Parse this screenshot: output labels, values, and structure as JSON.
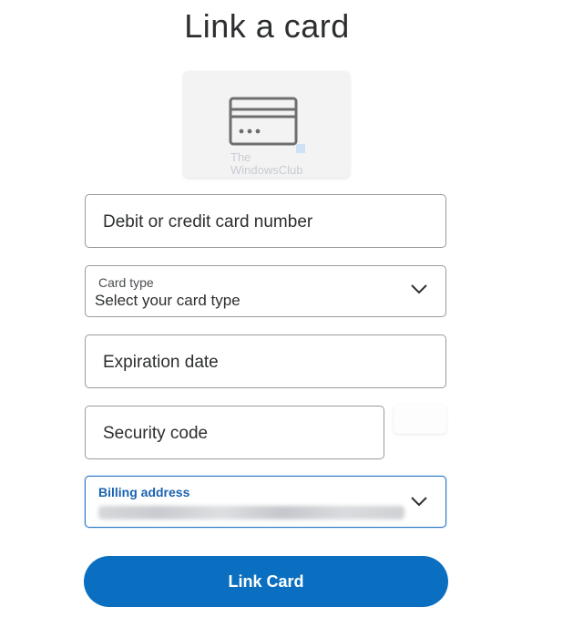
{
  "page": {
    "title": "Link a card"
  },
  "card_preview": {
    "icon": "credit-card-icon",
    "watermark_line1": "The",
    "watermark_line2": "WindowsClub"
  },
  "fields": {
    "card_number": {
      "placeholder": "Debit or credit card number"
    },
    "card_type": {
      "label": "Card type",
      "value": "Select your card type",
      "icon": "chevron-down-icon"
    },
    "expiration": {
      "placeholder": "Expiration date"
    },
    "security": {
      "placeholder": "Security code"
    },
    "billing": {
      "label": "Billing address",
      "icon": "chevron-down-icon"
    }
  },
  "actions": {
    "link_card_label": "Link Card"
  },
  "colors": {
    "primary": "#0a6fc0",
    "focus_border": "#2c77c3",
    "active_label": "#1a62b1"
  }
}
